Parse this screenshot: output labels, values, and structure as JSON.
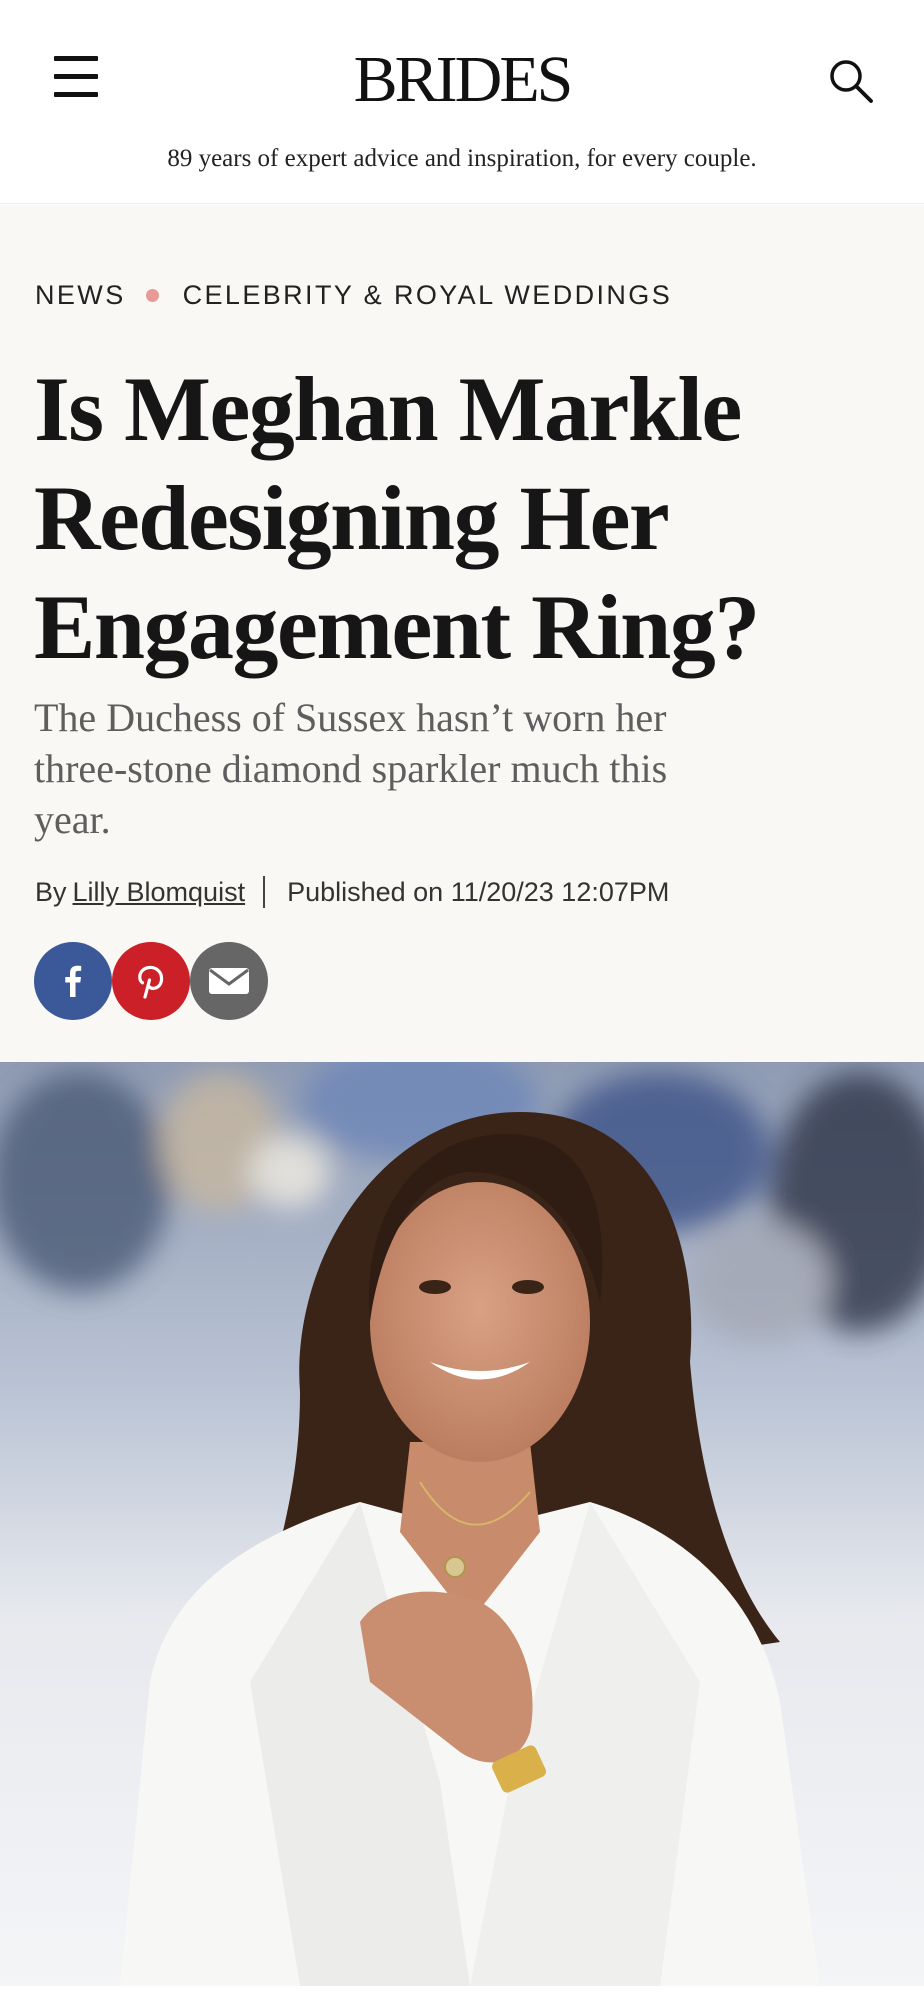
{
  "header": {
    "logo": "BRIDES",
    "tagline": "89 years of expert advice and inspiration, for every couple.",
    "menu_icon": "hamburger-menu-icon",
    "search_icon": "search-icon"
  },
  "breadcrumb": {
    "items": [
      "NEWS",
      "CELEBRITY & ROYAL WEDDINGS"
    ],
    "separator_color": "#e89a96"
  },
  "article": {
    "title_lines": [
      "Is Meghan Markle",
      "Redesigning Her",
      "Engagement Ring?"
    ],
    "subtitle_lines": [
      "The Duchess of Sussex hasn’t worn her",
      "three-stone diamond sparkler much this",
      "year."
    ],
    "by_prefix": "By",
    "author": "Lilly Blomquist",
    "published": "Published on 11/20/23 12:07PM"
  },
  "share": {
    "facebook": {
      "icon": "facebook-icon",
      "color": "#3b5998"
    },
    "pinterest": {
      "icon": "pinterest-icon",
      "color": "#cb2027"
    },
    "email": {
      "icon": "email-icon",
      "color": "#666666"
    }
  },
  "hero": {
    "description_icon": "hero-photo"
  }
}
